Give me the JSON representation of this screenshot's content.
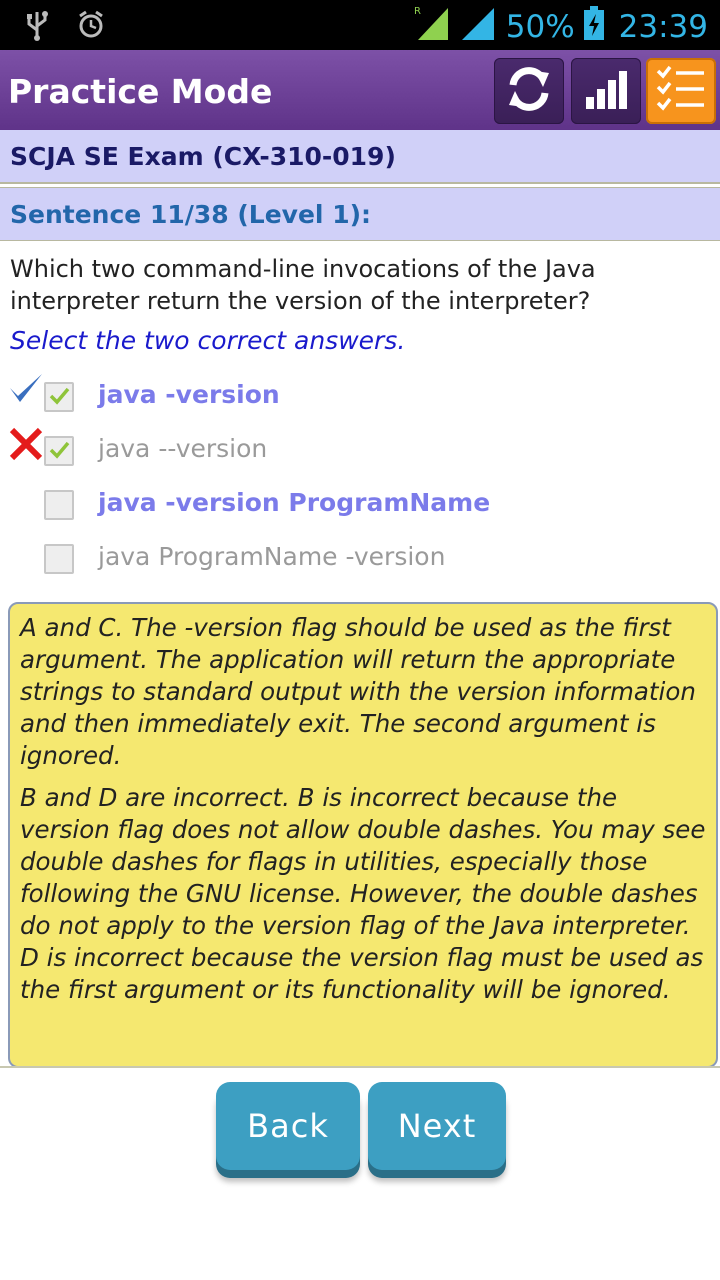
{
  "status_bar": {
    "battery_percent": "50%",
    "time": "23:39",
    "icons": [
      "usb-icon",
      "alarm-icon",
      "signal-icon",
      "battery-icon"
    ]
  },
  "header": {
    "title": "Practice Mode",
    "buttons": [
      "refresh-icon",
      "stats-icon",
      "list-icon"
    ]
  },
  "exam": {
    "title": "SCJA SE Exam (CX-310-019)"
  },
  "sentence": {
    "label": "Sentence 11/38 (Level 1):"
  },
  "question": {
    "text": "Which two command-line invocations of the Java interpreter return the version of the interpreter?",
    "instruction": "Select the two correct answers."
  },
  "options": [
    {
      "label": "java -version",
      "checked": true,
      "result": "correct",
      "is_answer": true
    },
    {
      "label": "java --version",
      "checked": true,
      "result": "wrong",
      "is_answer": false
    },
    {
      "label": "java -version ProgramName",
      "checked": false,
      "result": "",
      "is_answer": true
    },
    {
      "label": "java ProgramName -version",
      "checked": false,
      "result": "",
      "is_answer": false
    }
  ],
  "explanation": {
    "p1": "A and C. The -version flag should be used as the first argument. The application will return the appropriate strings to standard output with the version information and then immediately exit. The second argument is ignored.",
    "p2": "B and D are incorrect. B is incorrect because the version flag does not allow double dashes. You may see double dashes for flags in utilities, especially those following the GNU license. However, the double dashes do not apply to the version flag of the Java interpreter. D is incorrect because the version flag must be used as the first argument or its functionality will be ignored."
  },
  "nav": {
    "back_label": "Back",
    "next_label": "Next"
  },
  "colors": {
    "header": "#6a3d96",
    "bar": "#d0d0f8",
    "explanation_bg": "#f5e870",
    "button": "#3d9fc2",
    "correct_text": "#7b7bea"
  }
}
